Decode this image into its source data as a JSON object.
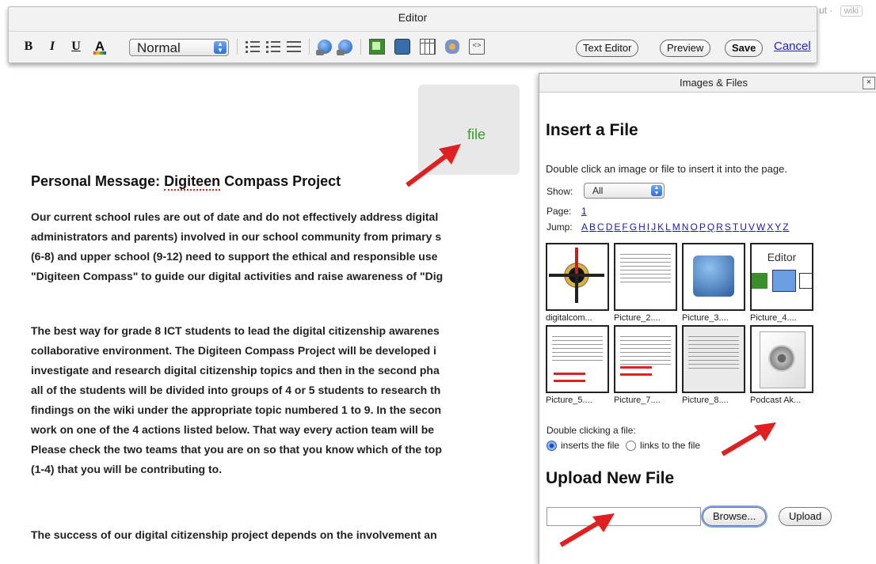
{
  "background": {
    "fragment_text": "ut ·",
    "wiki_pill": "wiki"
  },
  "editor": {
    "title": "Editor",
    "format_select_value": "Normal",
    "buttons": {
      "text_editor": "Text Editor",
      "preview": "Preview",
      "save": "Save",
      "cancel": "Cancel"
    },
    "bold_glyph": "B",
    "italic_glyph": "I",
    "underline_glyph": "U",
    "color_glyph": "A",
    "code_glyph": "<>"
  },
  "content": {
    "file_placeholder": "file",
    "heading_prefix": "Personal Message: ",
    "heading_word": "Digiteen",
    "heading_suffix": " Compass Project",
    "para1": [
      "Our current school rules are out of date and do not effectively address digital",
      "administrators and parents) involved in our school community from primary s",
      "(6-8) and upper school (9-12) need to support the ethical and responsible use",
      "\"Digiteen Compass\" to guide our digital activities and raise awareness of \"Dig"
    ],
    "para2": [
      "The best way for grade 8 ICT students to lead the digital citizenship awarenes",
      "collaborative environment. The Digiteen Compass Project will be developed i",
      "investigate and research digital citizenship topics and then in the second pha",
      "all of the students will be divided into groups of 4 or 5 students to research th",
      "findings on the wiki under the appropriate topic numbered 1 to 9. In the secon",
      "work on one of the 4 actions listed below. That way every action team will be",
      "Please check the two teams that you are on so that you know which of the top",
      "(1-4) that you will be contributing to."
    ],
    "para3": "The success of our digital citizenship project depends on the involvement an"
  },
  "panel": {
    "title": "Images & Files",
    "close_glyph": "×",
    "insert_heading": "Insert a File",
    "instructions": "Double click an image or file to insert it into the page.",
    "show_label": "Show:",
    "show_value": "All",
    "page_label": "Page:",
    "page_number": "1",
    "jump_label": "Jump:",
    "jump_letters": [
      "A",
      "B",
      "C",
      "D",
      "E",
      "F",
      "G",
      "H",
      "I",
      "J",
      "K",
      "L",
      "M",
      "N",
      "O",
      "P",
      "Q",
      "R",
      "S",
      "T",
      "U",
      "V",
      "W",
      "X",
      "Y",
      "Z"
    ],
    "thumbnails": [
      {
        "caption": "digitalcom..."
      },
      {
        "caption": "Picture_2...."
      },
      {
        "caption": "Picture_3...."
      },
      {
        "caption": "Picture_4...."
      },
      {
        "caption": "Picture_5...."
      },
      {
        "caption": "Picture_7...."
      },
      {
        "caption": "Picture_8...."
      },
      {
        "caption": "Podcast Ak..."
      }
    ],
    "thumb_editor_label": "Editor",
    "double_click_label": "Double clicking a file:",
    "option_inserts": "inserts the file",
    "option_links": "links to the file",
    "upload_heading": "Upload New File",
    "browse_button": "Browse...",
    "upload_button": "Upload"
  },
  "colors": {
    "link": "#2323b8",
    "arrow": "#e02020",
    "file_text": "#3c9a2f"
  }
}
